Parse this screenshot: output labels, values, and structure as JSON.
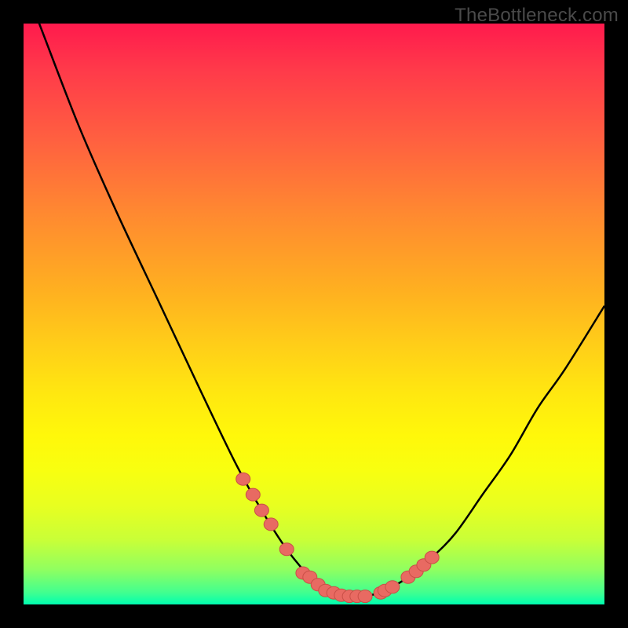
{
  "watermark": "TheBottleneck.com",
  "colors": {
    "gradient_top": "#ff1a4d",
    "gradient_bottom": "#00ffb0",
    "curve_stroke": "#000000",
    "marker_fill": "#e86a62",
    "marker_stroke": "#c94f47",
    "background": "#000000"
  },
  "chart_data": {
    "type": "line",
    "title": "",
    "xlabel": "",
    "ylabel": "",
    "xlim": [
      0,
      100
    ],
    "ylim": [
      0,
      100
    ],
    "series": [
      {
        "name": "bottleneck-curve",
        "x": [
          0,
          2.7,
          9.5,
          16,
          23,
          30,
          36.5,
          41,
          45.3,
          49.3,
          52,
          55.4,
          58.8,
          62.2,
          66.2,
          70.3,
          74.3,
          79,
          83.8,
          88.5,
          93.2,
          100
        ],
        "values": [
          106.8,
          100,
          82.4,
          67.6,
          52.7,
          37.8,
          24.3,
          16.2,
          9.5,
          4.7,
          2.4,
          1.4,
          1.4,
          2.4,
          4.7,
          8.1,
          12.2,
          18.9,
          25.7,
          33.8,
          40.5,
          51.4
        ]
      }
    ],
    "markers": {
      "name": "highlighted-models",
      "x": [
        37.8,
        39.5,
        41,
        42.6,
        45.3,
        48.1,
        49.3,
        50.7,
        52,
        53.4,
        54.7,
        56.1,
        57.4,
        58.8,
        61.5,
        62.2,
        63.5,
        66.2,
        67.6,
        68.9,
        70.3
      ],
      "values": [
        21.6,
        18.9,
        16.2,
        13.8,
        9.5,
        5.4,
        4.7,
        3.4,
        2.4,
        2,
        1.6,
        1.4,
        1.4,
        1.4,
        2,
        2.4,
        3,
        4.7,
        5.7,
        6.8,
        8.1
      ]
    }
  }
}
